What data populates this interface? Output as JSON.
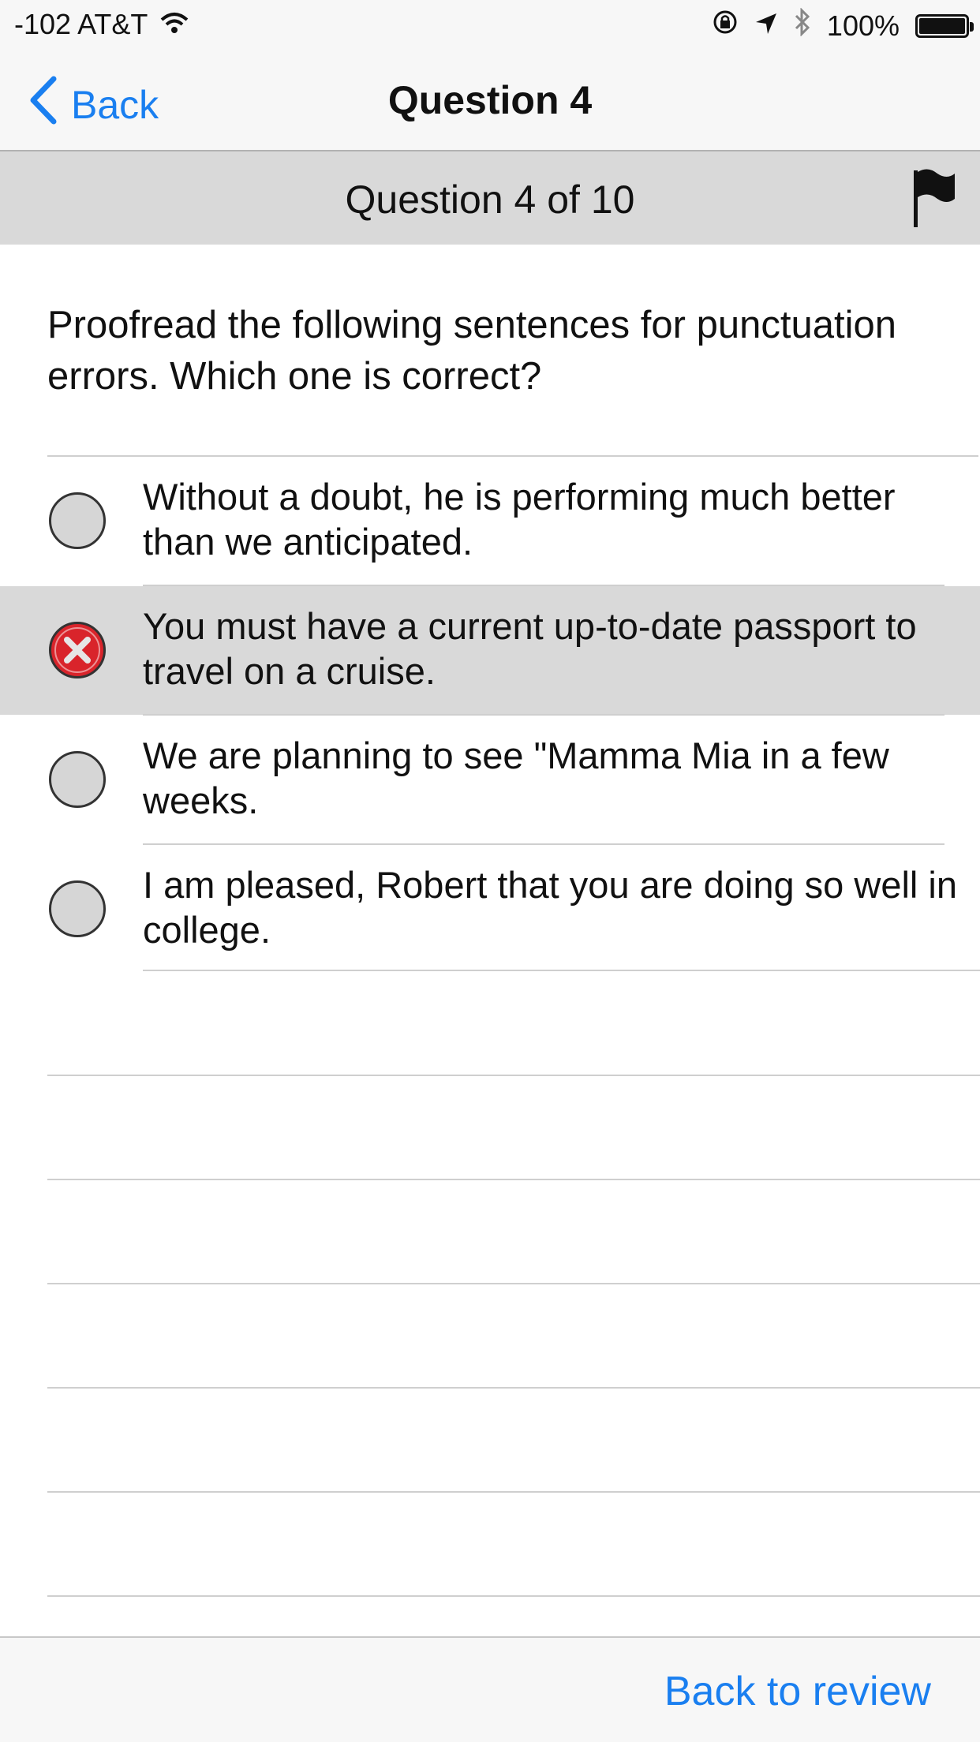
{
  "status_bar": {
    "carrier": "-102 AT&T",
    "battery": "100%",
    "battery_level": 1.0,
    "icons": [
      "wifi-icon",
      "orientation-lock-icon",
      "location-arrow-icon",
      "bluetooth-icon",
      "battery-icon"
    ]
  },
  "nav": {
    "back_label": "Back",
    "title": "Question 4"
  },
  "sub_header": {
    "title": "Question 4 of 10",
    "flag_icon": "flag-icon"
  },
  "question": {
    "text": "Proofread the following sentences for punctuation errors. Which one is correct?"
  },
  "answers": [
    {
      "text": "Without a doubt, he is performing much better than we anticipated.",
      "state": "unselected"
    },
    {
      "text": "You must have a current up-to-date passport to travel on a cruise.",
      "state": "selected-wrong"
    },
    {
      "text": "We are planning to see \"Mamma Mia in a few weeks.",
      "state": "unselected"
    },
    {
      "text": "I am pleased, Robert that you are doing so well in college.",
      "state": "unselected"
    }
  ],
  "colors": {
    "accent": "#1a7ff0",
    "wrong": "#d9242b",
    "selected_row": "#d9d9d9",
    "header_gray": "#d9d9d9"
  },
  "toolbar": {
    "back_to_review": "Back to review"
  }
}
